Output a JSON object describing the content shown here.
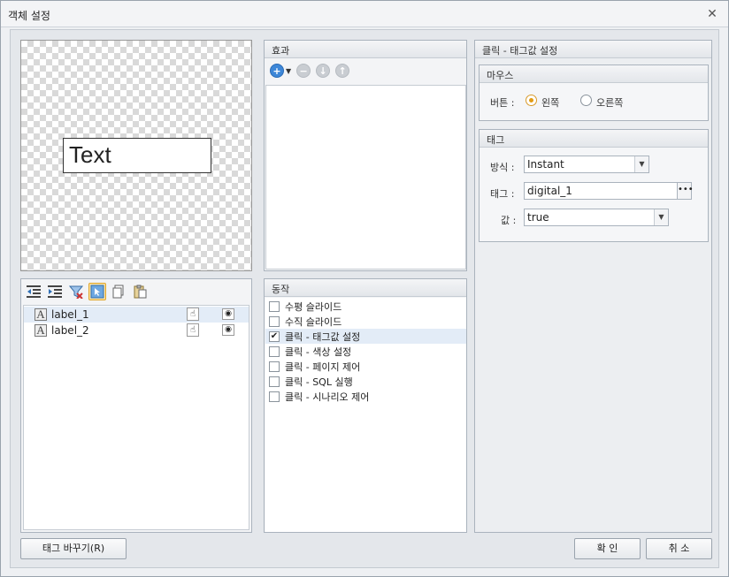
{
  "window": {
    "title": "객체 설정"
  },
  "preview": {
    "text": "Text"
  },
  "objects": {
    "items": [
      {
        "label": "label_1",
        "selected": true
      },
      {
        "label": "label_2",
        "selected": false
      }
    ]
  },
  "effects": {
    "title": "효과"
  },
  "actions": {
    "title": "동작",
    "items": [
      {
        "label": "수평 슬라이드",
        "checked": false
      },
      {
        "label": "수직 슬라이드",
        "checked": false
      },
      {
        "label": "클릭 - 태그값 설정",
        "checked": true
      },
      {
        "label": "클릭 - 색상 설정",
        "checked": false
      },
      {
        "label": "클릭 - 페이지 제어",
        "checked": false
      },
      {
        "label": "클릭 - SQL 실행",
        "checked": false
      },
      {
        "label": "클릭 - 시나리오 제어",
        "checked": false
      }
    ]
  },
  "settings": {
    "title": "클릭 - 태그값 설정",
    "mouse": {
      "title": "마우스",
      "button_label": "버튼 :",
      "left": "왼쪽",
      "right": "오른쪽",
      "selected": "left"
    },
    "tag": {
      "title": "태그",
      "method_label": "방식 :",
      "method_value": "Instant",
      "tag_label": "태그 :",
      "tag_value": "digital_1",
      "value_label": "값 :",
      "value_value": "true"
    }
  },
  "buttons": {
    "change_tag": "태그 바꾸기(R)",
    "ok": "확 인",
    "cancel": "취 소"
  }
}
